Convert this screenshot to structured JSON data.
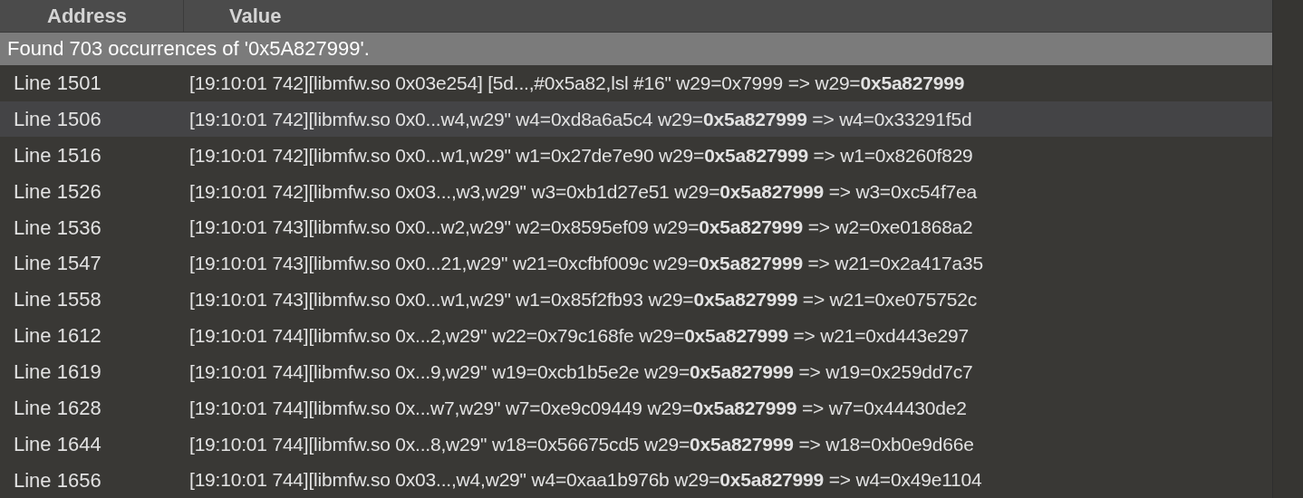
{
  "table": {
    "columns": [
      "Address",
      "Value"
    ],
    "search_result": "Found 703 occurrences of '0x5A827999'.",
    "rows": [
      {
        "address": "Line 1501",
        "value": "[19:10:01 742][libmfw.so 0x03e254] [5d...,#0x5a82,lsl #16\" w29=0x7999 => w29=**0x5a827999**",
        "selected": false
      },
      {
        "address": "Line 1506",
        "value": "[19:10:01 742][libmfw.so 0x0...w4,w29\" w4=0xd8a6a5c4 w29=**0x5a827999** => w4=0x33291f5d",
        "selected": true
      },
      {
        "address": "Line 1516",
        "value": "[19:10:01 742][libmfw.so 0x0...w1,w29\" w1=0x27de7e90 w29=**0x5a827999** => w1=0x8260f829",
        "selected": false
      },
      {
        "address": "Line 1526",
        "value": "[19:10:01 742][libmfw.so 0x03...,w3,w29\" w3=0xb1d27e51 w29=**0x5a827999** => w3=0xc54f7ea",
        "selected": false
      },
      {
        "address": "Line 1536",
        "value": "[19:10:01 743][libmfw.so 0x0...w2,w29\" w2=0x8595ef09 w29=**0x5a827999** => w2=0xe01868a2",
        "selected": false
      },
      {
        "address": "Line 1547",
        "value": "[19:10:01 743][libmfw.so 0x0...21,w29\" w21=0xcfbf009c w29=**0x5a827999** => w21=0x2a417a35",
        "selected": false
      },
      {
        "address": "Line 1558",
        "value": "[19:10:01 743][libmfw.so 0x0...w1,w29\" w1=0x85f2fb93 w29=**0x5a827999** => w21=0xe075752c",
        "selected": false
      },
      {
        "address": "Line 1612",
        "value": "[19:10:01 744][libmfw.so 0x...2,w29\" w22=0x79c168fe w29=**0x5a827999** => w21=0xd443e297",
        "selected": false
      },
      {
        "address": "Line 1619",
        "value": "[19:10:01 744][libmfw.so 0x...9,w29\" w19=0xcb1b5e2e w29=**0x5a827999** => w19=0x259dd7c7",
        "selected": false
      },
      {
        "address": "Line 1628",
        "value": "[19:10:01 744][libmfw.so 0x...w7,w29\" w7=0xe9c09449 w29=**0x5a827999** => w7=0x44430de2",
        "selected": false
      },
      {
        "address": "Line 1644",
        "value": "[19:10:01 744][libmfw.so 0x...8,w29\" w18=0x56675cd5 w29=**0x5a827999** => w18=0xb0e9d66e",
        "selected": false
      },
      {
        "address": "Line 1656",
        "value": "[19:10:01 744][libmfw.so 0x03...,w4,w29\" w4=0xaa1b976b w29=**0x5a827999** => w4=0x49e1104",
        "selected": false
      }
    ]
  }
}
